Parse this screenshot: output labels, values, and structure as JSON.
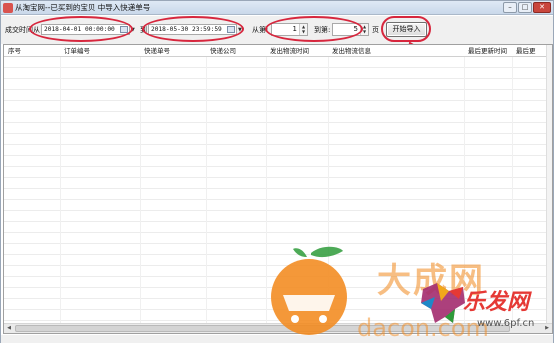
{
  "window": {
    "title": "从淘宝网--已买到的宝贝 中导入快递单号",
    "buttons": {
      "minimize": "–",
      "maximize": "□",
      "close": "✕"
    }
  },
  "toolbar": {
    "date_from_label": "成交时间从",
    "date_from_value": "2018-04-01 00:00:00",
    "date_to_label": "到",
    "date_to_value": "2018-05-30 23:59:59",
    "page_from_label": "从第:",
    "page_from_value": "1",
    "page_to_label": "到第:",
    "page_to_value": "5",
    "page_unit": "页",
    "import_button": "开始导入"
  },
  "grid": {
    "columns": [
      "序号",
      "订单编号",
      "快递单号",
      "快递公司",
      "发出物流时间",
      "发出物流信息",
      "最后更新时间",
      "最后更"
    ]
  },
  "watermark": {
    "brand_cn": "大成网",
    "brand_sub": "乐发网",
    "url_left": "dacon.com",
    "url_right": "www.6pf.cn"
  },
  "colors": {
    "annotation_red": "#d7263d",
    "orange": "#f28a1e",
    "leaf_green": "#2e9b3a"
  }
}
